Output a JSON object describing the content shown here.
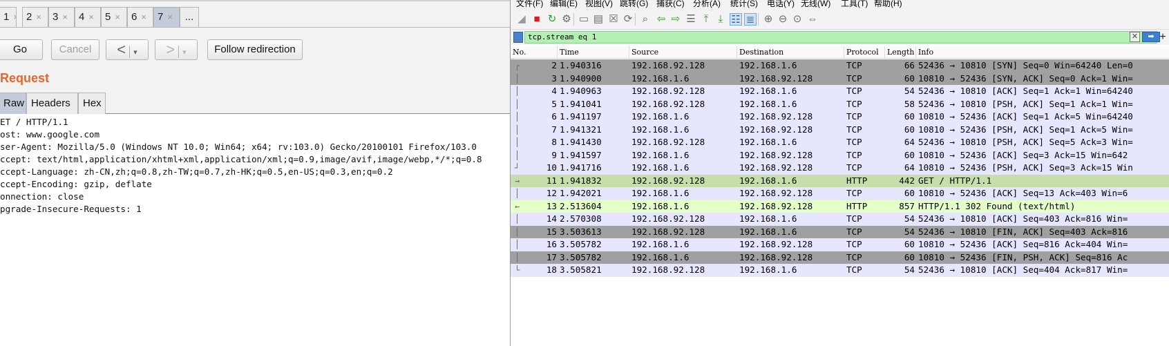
{
  "burp": {
    "request_tabs": [
      {
        "label": "1",
        "close": "×"
      },
      {
        "label": "2",
        "close": "×"
      },
      {
        "label": "3",
        "close": "×"
      },
      {
        "label": "4",
        "close": "×"
      },
      {
        "label": "5",
        "close": "×"
      },
      {
        "label": "6",
        "close": "×"
      },
      {
        "label": "7",
        "close": "×"
      },
      {
        "label": "...",
        "close": ""
      }
    ],
    "active_tab": "7",
    "go_label": "Go",
    "cancel_label": "Cancel",
    "back_label": "<",
    "forward_label": ">",
    "dropdown_caret": "▾",
    "follow_label": "Follow redirection",
    "section_title": "Request",
    "subtabs": [
      "Raw",
      "Headers",
      "Hex"
    ],
    "request_lines": [
      "ET / HTTP/1.1",
      "ost: www.google.com",
      "ser-Agent: Mozilla/5.0 (Windows NT 10.0; Win64; x64; rv:103.0) Gecko/20100101 Firefox/103.0",
      "ccept: text/html,application/xhtml+xml,application/xml;q=0.9,image/avif,image/webp,*/*;q=0.8",
      "ccept-Language: zh-CN,zh;q=0.8,zh-TW;q=0.7,zh-HK;q=0.5,en-US;q=0.3,en;q=0.2",
      "ccept-Encoding: gzip, deflate",
      "onnection: close",
      "pgrade-Insecure-Requests: 1"
    ]
  },
  "wireshark": {
    "menu": [
      "文件(F)",
      "编辑(E)",
      "视图(V)",
      "跳转(G)",
      "捕获(C)",
      "分析(A)",
      "统计(S)",
      "电话(Y)",
      "无线(W)",
      "工具(T)",
      "帮助(H)"
    ],
    "toolbar_icons": [
      "shark-fin-icon",
      "stop-capture-icon",
      "restart-capture-icon",
      "capture-options-icon",
      "open-file-icon",
      "save-file-icon",
      "close-file-icon",
      "reload-file-icon",
      "find-packet-icon",
      "go-back-icon",
      "go-forward-icon",
      "go-to-packet-icon",
      "go-first-icon",
      "go-last-icon",
      "autoscroll-icon",
      "colorize-icon",
      "zoom-in-icon",
      "zoom-out-icon",
      "zoom-normal-icon",
      "resize-columns-icon"
    ],
    "filter": {
      "value": "tcp.stream eq 1",
      "clear_glyph": "✕",
      "apply_glyph": "➡",
      "add_glyph": "+"
    },
    "columns": [
      "No.",
      "Time",
      "Source",
      "Destination",
      "Protocol",
      "Length",
      "Info"
    ],
    "colors": {
      "row_normal": "#e7e6ff",
      "row_dark": "#a0a0a0",
      "row_http": "#c6dfaa",
      "row_http_light": "#e4ffc7",
      "filter_ok": "#b3f0b3",
      "burp_orange": "#e8662b"
    },
    "packets": [
      {
        "no": "2",
        "time": "1.940316",
        "src": "192.168.92.128",
        "dst": "192.168.1.6",
        "proto": "TCP",
        "len": "66",
        "info": "52436 → 10810 [SYN] Seq=0 Win=64240 Len=0",
        "style": "dark",
        "bracket": "┌"
      },
      {
        "no": "3",
        "time": "1.940900",
        "src": "192.168.1.6",
        "dst": "192.168.92.128",
        "proto": "TCP",
        "len": "60",
        "info": "10810 → 52436 [SYN, ACK] Seq=0 Ack=1 Win=",
        "style": "dark",
        "bracket": "│"
      },
      {
        "no": "4",
        "time": "1.940963",
        "src": "192.168.92.128",
        "dst": "192.168.1.6",
        "proto": "TCP",
        "len": "54",
        "info": "52436 → 10810 [ACK] Seq=1 Ack=1 Win=64240",
        "style": "normal",
        "bracket": "│"
      },
      {
        "no": "5",
        "time": "1.941041",
        "src": "192.168.92.128",
        "dst": "192.168.1.6",
        "proto": "TCP",
        "len": "58",
        "info": "52436 → 10810 [PSH, ACK] Seq=1 Ack=1 Win=",
        "style": "normal",
        "bracket": "│"
      },
      {
        "no": "6",
        "time": "1.941197",
        "src": "192.168.1.6",
        "dst": "192.168.92.128",
        "proto": "TCP",
        "len": "60",
        "info": "10810 → 52436 [ACK] Seq=1 Ack=5 Win=64240",
        "style": "normal",
        "bracket": "│"
      },
      {
        "no": "7",
        "time": "1.941321",
        "src": "192.168.1.6",
        "dst": "192.168.92.128",
        "proto": "TCP",
        "len": "60",
        "info": "10810 → 52436 [PSH, ACK] Seq=1 Ack=5 Win=",
        "style": "normal",
        "bracket": "│"
      },
      {
        "no": "8",
        "time": "1.941430",
        "src": "192.168.92.128",
        "dst": "192.168.1.6",
        "proto": "TCP",
        "len": "64",
        "info": "52436 → 10810 [PSH, ACK] Seq=5 Ack=3 Win=",
        "style": "normal",
        "bracket": "│"
      },
      {
        "no": "9",
        "time": "1.941597",
        "src": "192.168.1.6",
        "dst": "192.168.92.128",
        "proto": "TCP",
        "len": "60",
        "info": "10810 → 52436 [ACK] Seq=3 Ack=15 Win=642",
        "style": "normal",
        "bracket": "│"
      },
      {
        "no": "10",
        "time": "1.941716",
        "src": "192.168.1.6",
        "dst": "192.168.92.128",
        "proto": "TCP",
        "len": "64",
        "info": "10810 → 52436 [PSH, ACK] Seq=3 Ack=15 Win",
        "style": "normal",
        "bracket": "┘"
      },
      {
        "no": "11",
        "time": "1.941832",
        "src": "192.168.92.128",
        "dst": "192.168.1.6",
        "proto": "HTTP",
        "len": "442",
        "info": "GET / HTTP/1.1",
        "style": "http",
        "bracket": "→"
      },
      {
        "no": "12",
        "time": "1.942021",
        "src": "192.168.1.6",
        "dst": "192.168.92.128",
        "proto": "TCP",
        "len": "60",
        "info": "10810 → 52436 [ACK] Seq=13 Ack=403 Win=6",
        "style": "normal",
        "bracket": "│"
      },
      {
        "no": "13",
        "time": "2.513604",
        "src": "192.168.1.6",
        "dst": "192.168.92.128",
        "proto": "HTTP",
        "len": "857",
        "info": "HTTP/1.1 302 Found  (text/html)",
        "style": "http_light",
        "bracket": "←"
      },
      {
        "no": "14",
        "time": "2.570308",
        "src": "192.168.92.128",
        "dst": "192.168.1.6",
        "proto": "TCP",
        "len": "54",
        "info": "52436 → 10810 [ACK] Seq=403 Ack=816 Win=",
        "style": "normal",
        "bracket": "│"
      },
      {
        "no": "15",
        "time": "3.503613",
        "src": "192.168.92.128",
        "dst": "192.168.1.6",
        "proto": "TCP",
        "len": "54",
        "info": "52436 → 10810 [FIN, ACK] Seq=403 Ack=816",
        "style": "dark",
        "bracket": "│"
      },
      {
        "no": "16",
        "time": "3.505782",
        "src": "192.168.1.6",
        "dst": "192.168.92.128",
        "proto": "TCP",
        "len": "60",
        "info": "10810 → 52436 [ACK] Seq=816 Ack=404 Win=",
        "style": "normal",
        "bracket": "│"
      },
      {
        "no": "17",
        "time": "3.505782",
        "src": "192.168.1.6",
        "dst": "192.168.92.128",
        "proto": "TCP",
        "len": "60",
        "info": "10810 → 52436 [FIN, PSH, ACK] Seq=816 Ac",
        "style": "dark",
        "bracket": "│"
      },
      {
        "no": "18",
        "time": "3.505821",
        "src": "192.168.92.128",
        "dst": "192.168.1.6",
        "proto": "TCP",
        "len": "54",
        "info": "52436 → 10810 [ACK] Seq=404 Ack=817 Win=",
        "style": "normal",
        "bracket": "└"
      }
    ]
  }
}
